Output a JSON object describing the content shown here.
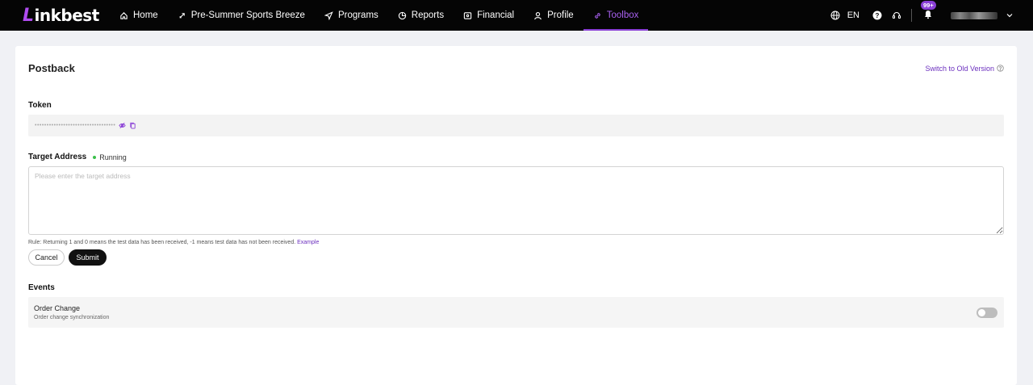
{
  "nav": {
    "logo_mark": "L",
    "logo_text": "inkbest",
    "items": [
      {
        "label": "Home",
        "icon": "home-icon"
      },
      {
        "label": "Pre-Summer Sports Breeze",
        "icon": "rocket-icon"
      },
      {
        "label": "Programs",
        "icon": "send-icon"
      },
      {
        "label": "Reports",
        "icon": "chart-icon"
      },
      {
        "label": "Financial",
        "icon": "wallet-icon"
      },
      {
        "label": "Profile",
        "icon": "user-icon"
      },
      {
        "label": "Toolbox",
        "icon": "link-icon",
        "active": true
      }
    ],
    "language": "EN",
    "notification_count": "99+"
  },
  "page": {
    "title": "Postback",
    "switch_link": "Switch to Old Version"
  },
  "token": {
    "label": "Token",
    "value": "••••••••••••••••••••••••••••••••••"
  },
  "target": {
    "label": "Target Address",
    "status": "Running",
    "placeholder": "Please enter the target address"
  },
  "rule": {
    "text": "Rule: Returning 1 and 0 means the test data has been received, -1 means test data has not been received.",
    "link": "Example"
  },
  "buttons": {
    "cancel": "Cancel",
    "submit": "Submit"
  },
  "events": {
    "label": "Events",
    "items": [
      {
        "title": "Order Change",
        "description": "Order change synchronization",
        "enabled": false
      }
    ]
  },
  "colors": {
    "accent": "#8a3fd6",
    "status_running": "#3bbf4a",
    "nav_bg": "#050505"
  }
}
